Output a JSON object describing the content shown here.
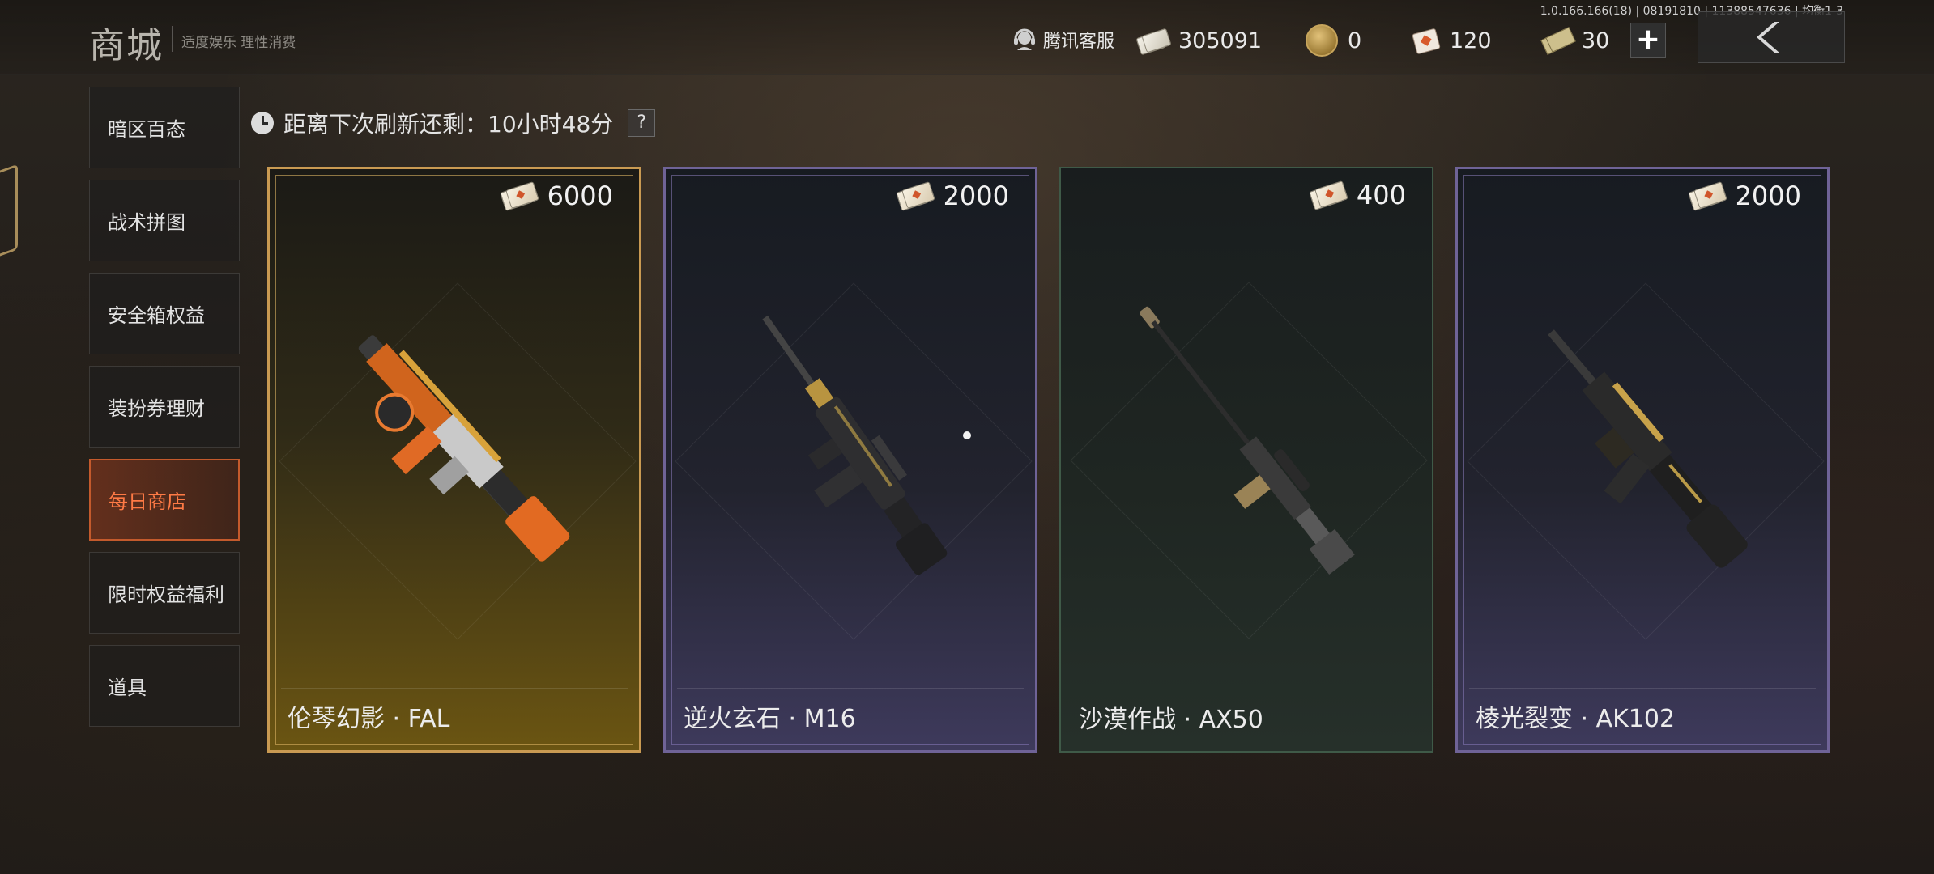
{
  "header": {
    "title": "商城",
    "subtitle": "适度娱乐 理性消费",
    "version": "1.0.166.166(18) | 08191810 | 11388547636 | 均衡1-3",
    "customer_service": "腾讯客服",
    "currencies": [
      {
        "icon": "ticket-bundle-icon",
        "value": "305091"
      },
      {
        "icon": "gold-coin-icon",
        "value": "0"
      },
      {
        "icon": "card-coupon-icon",
        "value": "120"
      },
      {
        "icon": "cash-bill-icon",
        "value": "30"
      }
    ],
    "plus_label": "+"
  },
  "sidebar": {
    "items": [
      {
        "label": "暗区百态",
        "active": false
      },
      {
        "label": "战术拼图",
        "active": false
      },
      {
        "label": "安全箱权益",
        "active": false
      },
      {
        "label": "装扮券理财",
        "active": false
      },
      {
        "label": "每日商店",
        "active": true
      },
      {
        "label": "限时权益福利",
        "active": false
      },
      {
        "label": "道具",
        "active": false
      }
    ]
  },
  "refresh": {
    "text": "距离下次刷新还剩：10小时48分",
    "help_label": "?"
  },
  "cards": [
    {
      "name": "伦琴幻影 · FAL",
      "price": "6000",
      "rarity": "gold",
      "accent": "#c99a52"
    },
    {
      "name": "逆火玄石 · M16",
      "price": "2000",
      "rarity": "purple",
      "accent": "#6f6397"
    },
    {
      "name": "沙漠作战 · AX50",
      "price": "400",
      "rarity": "green",
      "accent": "#3f5a48"
    },
    {
      "name": "棱光裂变 · AK102",
      "price": "2000",
      "rarity": "purple",
      "accent": "#6f6397"
    }
  ]
}
